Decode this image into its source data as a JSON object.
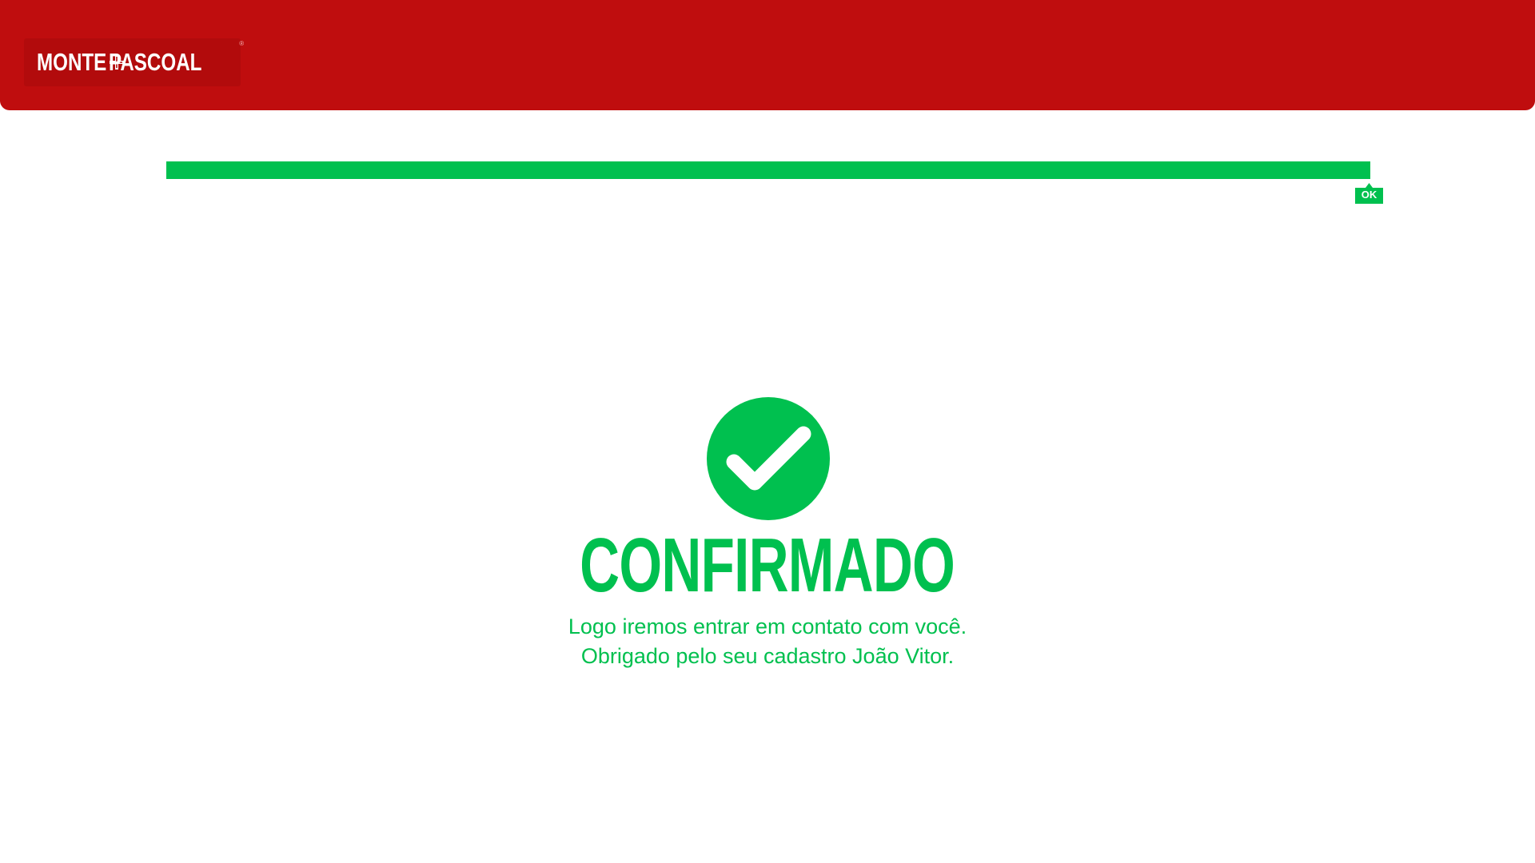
{
  "brand": {
    "name_first": "MONTE",
    "name_second": "PASCOAL",
    "registered_mark": "®",
    "colors": {
      "header": "#bf0d0e",
      "accent": "#00c04f"
    }
  },
  "progress": {
    "value_percent": 100,
    "tag_label": "OK"
  },
  "confirmation": {
    "icon": "check-circle-icon",
    "title": "CONFIRMADO",
    "line1": "Logo iremos entrar em contato com você.",
    "line2": "Obrigado pelo seu cadastro João Vitor."
  }
}
